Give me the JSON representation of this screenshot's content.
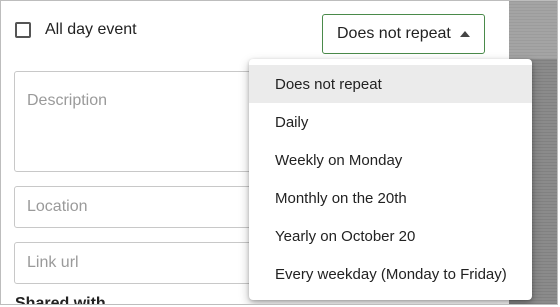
{
  "all_day": {
    "label": "All day event",
    "checked": false
  },
  "repeat": {
    "selected": "Does not repeat",
    "options": [
      "Does not repeat",
      "Daily",
      "Weekly on Monday",
      "Monthly on the 20th",
      "Yearly on October 20",
      "Every weekday (Monday to Friday)"
    ]
  },
  "fields": {
    "description_placeholder": "Description",
    "location_placeholder": "Location",
    "link_url_placeholder": "Link url"
  },
  "shared_with_heading": "Shared with",
  "colors": {
    "accent_border": "#4a8a4a",
    "selected_bg": "#ebebeb"
  }
}
